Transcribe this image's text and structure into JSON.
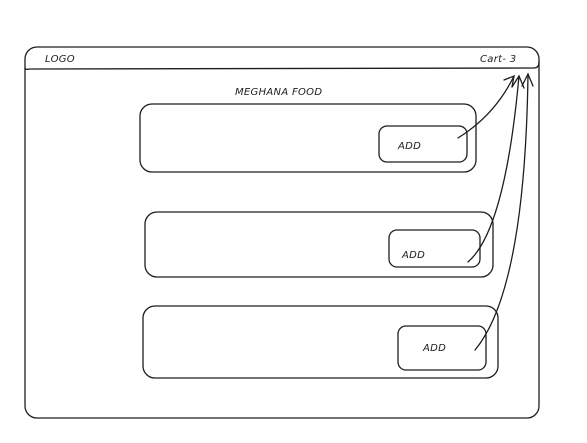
{
  "header": {
    "logo": "LOGO",
    "cart": "Cart- 3"
  },
  "main": {
    "title": "MEGHANA FOOD",
    "items": [
      {
        "button_label": "ADD"
      },
      {
        "button_label": "ADD"
      },
      {
        "button_label": "ADD"
      }
    ]
  },
  "colors": {
    "stroke": "#1e1e1e",
    "background": "#ffffff"
  }
}
